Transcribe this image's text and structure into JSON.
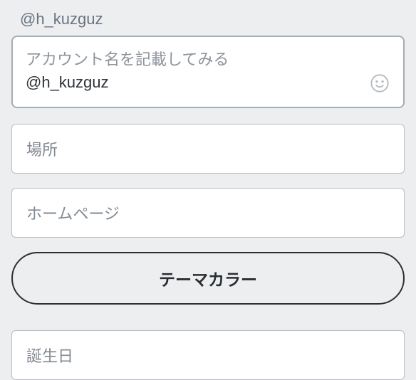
{
  "profile": {
    "username": "@h_kuzguz",
    "bio_placeholder": "アカウント名を記載してみる",
    "bio_value": "@h_kuzguz",
    "location_placeholder": "場所",
    "website_placeholder": "ホームページ",
    "theme_button_label": "テーマカラー",
    "birthday_placeholder": "誕生日"
  },
  "icons": {
    "emoji": "smile-icon"
  }
}
